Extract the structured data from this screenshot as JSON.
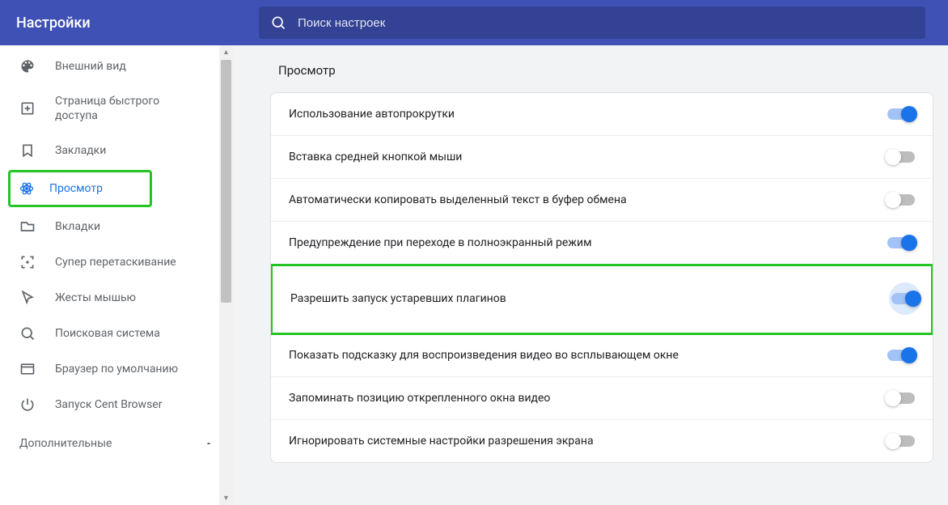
{
  "header": {
    "title": "Настройки",
    "search_placeholder": "Поиск настроек"
  },
  "sidebar": {
    "items": [
      {
        "id": "appearance",
        "label": "Внешний вид",
        "icon": "palette-icon"
      },
      {
        "id": "speed-dial",
        "label": "Страница быстрого доступа",
        "icon": "plus-box-icon"
      },
      {
        "id": "bookmarks",
        "label": "Закладки",
        "icon": "bookmark-icon"
      },
      {
        "id": "browsing",
        "label": "Просмотр",
        "icon": "atom-icon",
        "active": true,
        "highlight": true
      },
      {
        "id": "tabs",
        "label": "Вкладки",
        "icon": "tab-icon"
      },
      {
        "id": "super-drag",
        "label": "Супер перетаскивание",
        "icon": "focus-icon"
      },
      {
        "id": "mouse-gestures",
        "label": "Жесты мышью",
        "icon": "cursor-icon"
      },
      {
        "id": "search-engine",
        "label": "Поисковая система",
        "icon": "search-icon"
      },
      {
        "id": "default-browser",
        "label": "Браузер по умолчанию",
        "icon": "browser-icon"
      },
      {
        "id": "startup",
        "label": "Запуск Cent Browser",
        "icon": "power-icon"
      }
    ],
    "advanced_label": "Дополнительные"
  },
  "main": {
    "section_title": "Просмотр",
    "rows": [
      {
        "label": "Использование автопрокрутки",
        "on": true
      },
      {
        "label": "Вставка средней кнопкой мыши",
        "on": false
      },
      {
        "label": "Автоматически копировать выделенный текст в буфер обмена",
        "on": false
      },
      {
        "label": "Предупреждение при переходе в полноэкранный режим",
        "on": true
      },
      {
        "label": "Разрешить запуск устаревших плагинов",
        "on": true,
        "highlight": true,
        "halo": true
      },
      {
        "label": "Показать подсказку для воспроизведения видео во всплывающем окне",
        "on": true
      },
      {
        "label": "Запоминать позицию открепленного окна видео",
        "on": false
      },
      {
        "label": "Игнорировать системные настройки разрешения экрана",
        "on": false
      }
    ]
  }
}
